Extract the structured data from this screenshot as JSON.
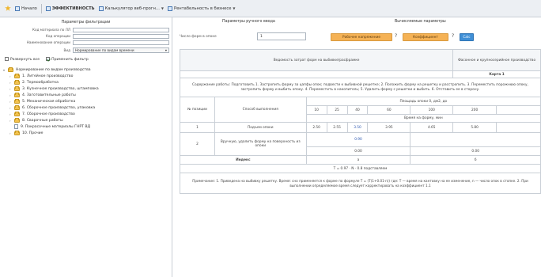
{
  "toolbar": {
    "home_label": "Начало",
    "section_label": "ЭФФЕКТИВНОСТЬ",
    "tab2_label": "Калькулятор веб-прогн...",
    "tab3_label": "Рентабельность в бизнесе",
    "accent": "#f0b52a"
  },
  "filters": {
    "title": "Параметры фильтрации",
    "fields": [
      {
        "label": "Код материала по ЛЛ",
        "value": ""
      },
      {
        "label": "Код операции",
        "value": ""
      },
      {
        "label": "Наименование операции",
        "value": ""
      }
    ],
    "select_label": "Вид",
    "select_value": "Нормирование по видам времени",
    "checkbox_all": "Развернуть все",
    "checkbox_filter": "Применить фильтр"
  },
  "tree": {
    "root": "Нормирование по видам производства",
    "items": [
      "1. Литейное производство",
      "2. Термообработка",
      "3. Кузнечное производство, штамповка",
      "4. Заготовительные работы",
      "5. Механическая обработка",
      "6. Сборочное производство, упаковка",
      "7. Сборочное производство",
      "8. Сварочные работы",
      "9. Покрасочные материалы ГНРТ ВД",
      "10. Прочие"
    ]
  },
  "calc": {
    "title_left": "Параметры ручного ввода",
    "title_right": "Вычисляемые параметры",
    "input_label": "Число форм в опоке",
    "input_value": "1",
    "btn1": "Рабочее напряжение",
    "btn2": "Коэффициент",
    "btn3": "Calc",
    "qmark": "?"
  },
  "table": {
    "header_title": "Ведомость затрат форм на выбивке/расфрамке",
    "header_right1": "Фасонное и крупносерийное производство",
    "header_right2": "Карта 1",
    "description": "Содержание работы: Подготовить 1. Застропить форму за цапфы опок; подвести к выбивной решетке; 2. Положить форму на решетку и расстропить. 3. Переместить порожнюю опоку, застропить форму и выбить опоку. 4. Переместить в накопитель; 5. Удалить форму с решетки и выбить. 6. Отставить ее в сторону.",
    "col_num": "№ позиции",
    "col_method": "Способ выполнения",
    "area_label": "Площадь опоки 0, дм2, до",
    "area_cols": [
      "10",
      "25",
      "40",
      "60",
      "100",
      "200"
    ],
    "time_label": "Время на форму, мин",
    "row1_num": "1",
    "row1_method": "Подъем опоки",
    "row1_vals": [
      "2.50",
      "2.55",
      "3.50",
      "3.95",
      "4.65",
      "5.80"
    ],
    "row2_num": "2",
    "row2_method": "Вручную, удалить форму на поверхность из опоки",
    "row2_val1": "0.90",
    "row2_val2a": "0.00",
    "row2_val2b": "0.00",
    "row_index_label": "Индекс",
    "row_index_a": "а",
    "row_index_b": "б",
    "formula": "T = 0.97 · N · 0.8   подставляем",
    "footnote": "Примечание: 1. Приведена на выбивку решетку. Время: сно применяется к форме по формуле T = (T(1+0.01·n)) где: T — время на кантовку на ее изменение, n — число опок в стопке. 2. При выполнении определяемое время следует корректировать на коэффициент 1.1"
  }
}
